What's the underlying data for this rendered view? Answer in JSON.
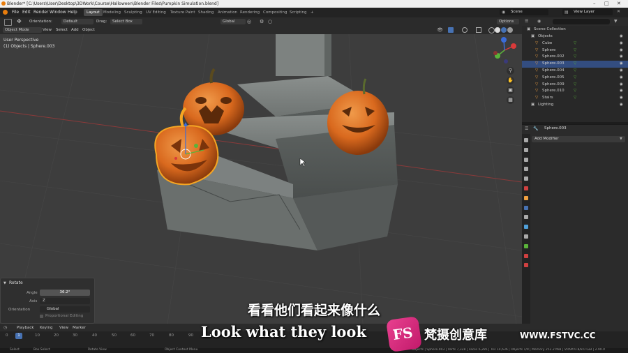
{
  "window": {
    "title": "Blender* [C:\\Users\\User\\Desktop\\3DWork\\Course\\Halloween\\Blender Files\\Pumpkin Simulation.blend]"
  },
  "menu": {
    "items": [
      "File",
      "Edit",
      "Render",
      "Window",
      "Help"
    ]
  },
  "workspaces": {
    "tabs": [
      "Layout",
      "Modeling",
      "Sculpting",
      "UV Editing",
      "Texture Paint",
      "Shading",
      "Animation",
      "Rendering",
      "Compositing",
      "Scripting"
    ],
    "active": "Layout",
    "add": "+"
  },
  "scene": {
    "label": "Scene",
    "view_layer": "View Layer"
  },
  "toolbar": {
    "orientation_label": "Orientation:",
    "orientation_value": "Default",
    "drag_label": "Drag:",
    "drag_value": "Select Box",
    "transform_orientation": "Global",
    "options": "Options"
  },
  "header": {
    "mode": "Object Mode",
    "menus": [
      "View",
      "Select",
      "Add",
      "Object"
    ]
  },
  "viewport": {
    "perspective": "User Perspective",
    "context": "(1) Objects | Sphere.003"
  },
  "outliner": {
    "search_placeholder": "",
    "collection": "Scene Collection",
    "items": [
      {
        "name": "Objects",
        "type": "collection"
      },
      {
        "name": "Cube",
        "type": "mesh"
      },
      {
        "name": "Sphere",
        "type": "mesh"
      },
      {
        "name": "Sphere.002",
        "type": "mesh"
      },
      {
        "name": "Sphere.003",
        "type": "mesh",
        "selected": true
      },
      {
        "name": "Sphere.004",
        "type": "mesh"
      },
      {
        "name": "Sphere.005",
        "type": "mesh"
      },
      {
        "name": "Sphere.009",
        "type": "mesh"
      },
      {
        "name": "Sphere.010",
        "type": "mesh"
      },
      {
        "name": "Stairs",
        "type": "mesh"
      },
      {
        "name": "Lighting",
        "type": "collection"
      }
    ]
  },
  "properties": {
    "object_name": "Sphere.003",
    "add_modifier": "Add Modifier"
  },
  "rotate_panel": {
    "title": "Rotate",
    "angle_label": "Angle",
    "angle_value": "36.2°",
    "axis_label": "Axis",
    "axis_value": "Z",
    "orientation_label": "Orientation",
    "orientation_value": "Global",
    "proportional": "Proportional Editing"
  },
  "timeline": {
    "menus": [
      "Playback",
      "Keying",
      "View",
      "Marker"
    ],
    "current_frame": "1",
    "ticks": [
      "0",
      "10",
      "20",
      "30",
      "40",
      "50",
      "60",
      "70",
      "80",
      "90"
    ],
    "status_left": "Select",
    "status_mid1": "Box Select",
    "status_mid2": "Rotate View",
    "status_mid3": "Object Context Menu",
    "status_right": "Objects | Sphere.003 | Verts 7,328 | Faces 6,285 | Tris 14,636 | Objects 1/9 | Memory 252.2 MiB | VRAM 0.8/8.0 GiB | 2.90.0"
  },
  "subtitles": {
    "chinese": "看看他们看起来像什么",
    "english": "Look what they look"
  },
  "watermark": {
    "logo": "FS",
    "brand": "梵摄创意库",
    "url": "WWW.FSTVC.CC"
  },
  "colors": {
    "accent_blue": "#4772b3",
    "selection_orange": "#f5a623",
    "pumpkin": "#d9691e",
    "stone": "#6f7472"
  }
}
